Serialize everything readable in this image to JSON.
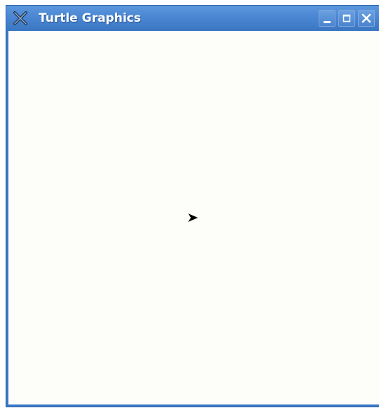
{
  "window": {
    "title": "Turtle Graphics",
    "app_icon": "x-close-icon",
    "controls": {
      "minimize_icon": "minimize-icon",
      "maximize_icon": "maximize-icon",
      "close_icon": "close-icon"
    }
  },
  "canvas": {
    "background": "#fdfdf9",
    "turtle": {
      "icon": "turtle-arrow-icon",
      "heading": "east",
      "color": "#000000"
    }
  },
  "colors": {
    "titlebar": "#4a86d2",
    "title_text": "#ffffff"
  }
}
